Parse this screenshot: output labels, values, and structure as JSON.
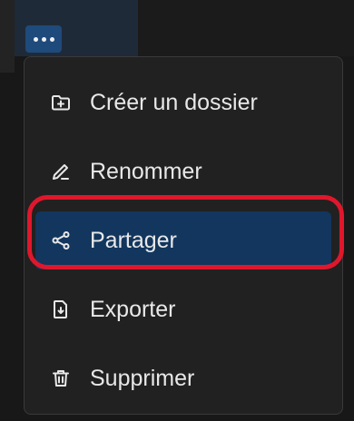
{
  "toolbar": {
    "more_button_icon": "ellipsis-horizontal-icon",
    "accent_color": "#1f4a7c"
  },
  "menu": {
    "items": [
      {
        "label": "Créer un dossier",
        "icon": "folder-plus-icon"
      },
      {
        "label": "Renommer",
        "icon": "pencil-icon"
      },
      {
        "label": "Partager",
        "icon": "share-icon",
        "selected": true
      },
      {
        "label": "Exporter",
        "icon": "file-export-icon"
      },
      {
        "label": "Supprimer",
        "icon": "trash-icon"
      }
    ],
    "selected_background": "#12365e",
    "highlight_outline_color": "#e0172c"
  }
}
